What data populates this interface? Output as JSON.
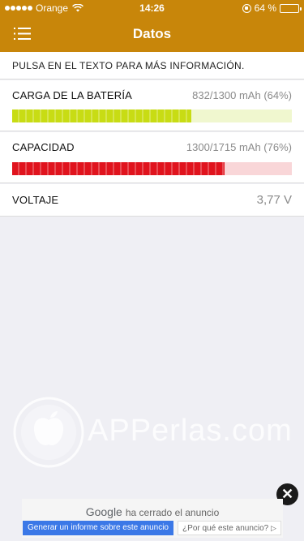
{
  "status_bar": {
    "carrier": "Orange",
    "time": "14:26",
    "battery_text": "64 %",
    "battery_level": 0.64
  },
  "nav": {
    "title": "Datos",
    "menu_icon": "list-menu-icon"
  },
  "hint": "PULSA EN EL TEXTO PARA MÁS INFORMACIÓN.",
  "rows": {
    "charge": {
      "label": "CARGA DE LA BATERÍA",
      "value": "832/1300 mAh (64%)",
      "fraction": 0.64,
      "fill_color": "#c8dc14",
      "track_color": "#f0f7cf"
    },
    "capacity": {
      "label": "CAPACIDAD",
      "value": "1300/1715 mAh (76%)",
      "fraction": 0.76,
      "fill_color": "#e0141e",
      "track_color": "#f9d6d8"
    },
    "voltage": {
      "label": "VOLTAJE",
      "value": "3,77 V"
    }
  },
  "watermark": "APPerlas.com",
  "ad": {
    "google": "Google",
    "closed_text": "ha cerrado el anuncio",
    "report_button": "Generar un informe sobre este anuncio",
    "why_button": "¿Por qué este anuncio?",
    "close_icon": "close-icon"
  },
  "colors": {
    "accent": "#c8860a",
    "background": "#efeff4"
  }
}
